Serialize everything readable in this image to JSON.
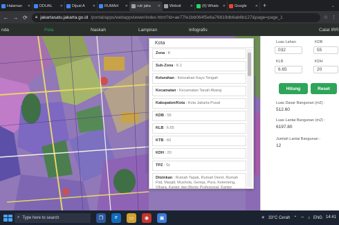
{
  "tabs": [
    {
      "label": "Halaman",
      "color": "#4285f4"
    },
    {
      "label": "DDUAL",
      "color": "#4285f4"
    },
    {
      "label": "Dijual A",
      "color": "#4285f4"
    },
    {
      "label": "RUMAH",
      "color": "#4285f4"
    },
    {
      "label": "rutr jaka",
      "color": "#9aa0a6"
    },
    {
      "label": "Websit",
      "color": "#9aa0a6"
    },
    {
      "label": "(6) Whats",
      "color": "#25d366"
    },
    {
      "label": "Google",
      "color": "#ea4335"
    }
  ],
  "address": {
    "host": "jakartasatu.jakarta.go.id",
    "path": "/portal/apps/webappviewer/index.html?id=ae77fe1bb064f5e6a76819db6ab6b127&page=page_1"
  },
  "nav": {
    "beranda": "nda",
    "peta": "Peta",
    "naskah": "Naskah",
    "lampiran": "Lampiran",
    "infografis": "Infografis",
    "katalog": "Catat IRR"
  },
  "popup": {
    "title": "Kota",
    "rows": [
      {
        "key": "Zona",
        "value": "K"
      },
      {
        "key": "Sub-Zona",
        "value": "K.1"
      },
      {
        "key": "Kelurahan",
        "value": "Kelurahan Kayu Tengah"
      },
      {
        "key": "Kecamatan",
        "value": "Kecamatan Tanah Abang"
      },
      {
        "key": "Kabupaten/Kota",
        "value": "Kota Jakarta Pusat"
      },
      {
        "key": "KDB",
        "value": "55"
      },
      {
        "key": "KLB",
        "value": "6.65"
      },
      {
        "key": "KTB",
        "value": "60"
      },
      {
        "key": "KDH",
        "value": "20"
      },
      {
        "key": "TPZ",
        "value": "St"
      }
    ],
    "diizinkan_key": "Diizinkan",
    "diizinkan_value": "Rumah Tapak, Rumah Deret, Rumah Flat, Masjid, Mushola, Gereja, Pura, Kelenteng, Vihara, Kantor dan Bisnis Profesional, Kantor Yayasan/Organisasi Kemasyarakatan, Kantor Lembaga Keuangan, Perkantoran Pemerintahan, Perkantoran Perwakilan Negara Asing, Toko Besar, Toko"
  },
  "panel": {
    "luas_lahan_label": "Luas Lahan",
    "luas_lahan_value": "032",
    "kdb_label": "KDB",
    "kdb_value": "55",
    "klb_label": "KLB",
    "klb_value": "6.65",
    "kdh_label": "KDH",
    "kdh_value": "20",
    "hitung_label": "Hitung",
    "reset_label": "Reset",
    "luas_dasar_label": "Luas Dasar Bangunan (m2) :",
    "luas_dasar_value": "512.60",
    "luas_lantai_label": "Luas Lantai Bangunan (m2) :",
    "luas_lantai_value": "6197.80",
    "jumlah_lantai_label": "Jumlah Lantai Bangunan :",
    "jumlah_lantai_value": "12"
  },
  "taskbar": {
    "search_placeholder": "Type here to search",
    "weather": "33°C Cerah",
    "lang": "ENG",
    "time": "14:41"
  }
}
